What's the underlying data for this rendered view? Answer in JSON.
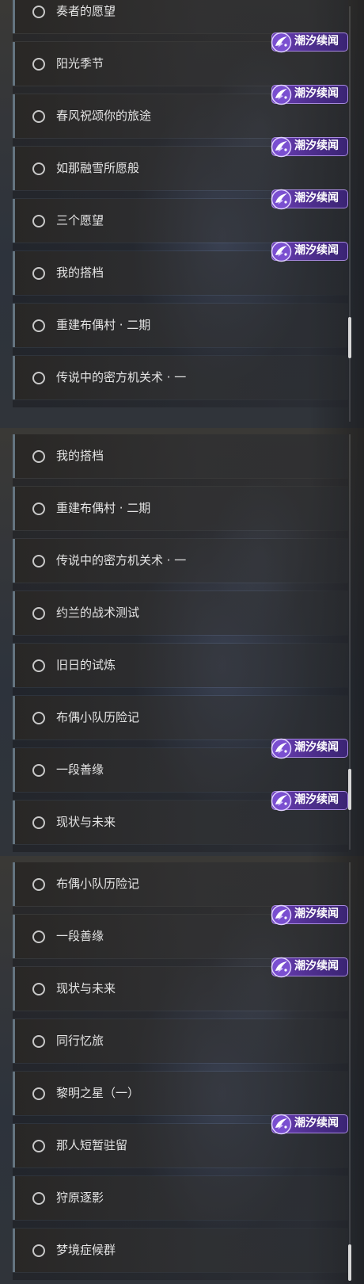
{
  "badge": {
    "text": "潮汐续闻"
  },
  "panels": [
    {
      "items": [
        {
          "label": "奏者的愿望",
          "badge": false
        },
        {
          "label": "阳光季节",
          "badge": true
        },
        {
          "label": "春风祝颂你的旅途",
          "badge": true
        },
        {
          "label": "如那融雪所愿般",
          "badge": true
        },
        {
          "label": "三个愿望",
          "badge": true
        },
        {
          "label": "我的搭档",
          "badge": true
        },
        {
          "label": "重建布偶村 · 二期",
          "badge": false
        },
        {
          "label": "传说中的密方机关术 · 一",
          "badge": false
        }
      ]
    },
    {
      "items": [
        {
          "label": "我的搭档",
          "badge": false
        },
        {
          "label": "重建布偶村 · 二期",
          "badge": false
        },
        {
          "label": "传说中的密方机关术 · 一",
          "badge": false
        },
        {
          "label": "约兰的战术测试",
          "badge": false
        },
        {
          "label": "旧日的试炼",
          "badge": false
        },
        {
          "label": "布偶小队历险记",
          "badge": false
        },
        {
          "label": "一段善缘",
          "badge": true
        },
        {
          "label": "现状与未来",
          "badge": true
        }
      ]
    },
    {
      "items": [
        {
          "label": "布偶小队历险记",
          "badge": false
        },
        {
          "label": "一段善缘",
          "badge": true
        },
        {
          "label": "现状与未来",
          "badge": true
        },
        {
          "label": "同行忆旅",
          "badge": false
        },
        {
          "label": "黎明之星（一）",
          "badge": false
        },
        {
          "label": "那人短暂驻留",
          "badge": true
        },
        {
          "label": "狩原逐影",
          "badge": false
        },
        {
          "label": "梦境症候群",
          "badge": false
        }
      ]
    }
  ],
  "colors": {
    "badge_bg": "#5a3aa0",
    "badge_border": "#a889e0",
    "row_accent": "#647480",
    "text": "#e4e4e4"
  }
}
